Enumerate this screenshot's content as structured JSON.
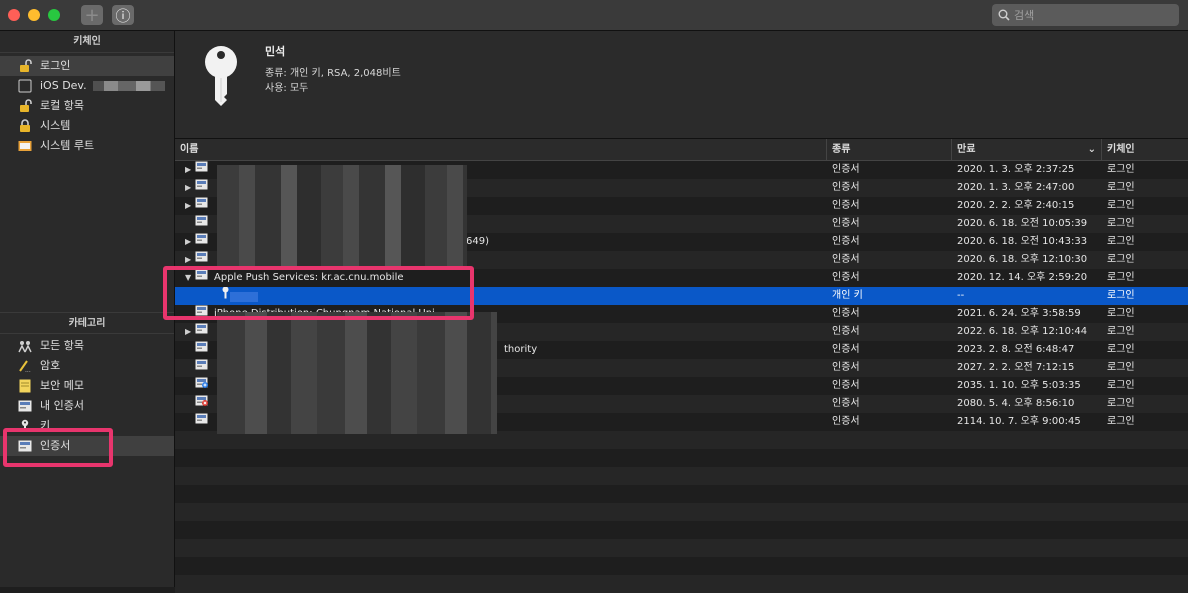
{
  "window": {
    "search_placeholder": "검색",
    "add_button": "+",
    "info_button": "ⓘ"
  },
  "sidebar": {
    "keychains_header": "키체인",
    "keychains": [
      {
        "label": "로그인",
        "icon": "open-lock-icon",
        "selected": true
      },
      {
        "label": "iOS Dev.",
        "icon": "dotted-box-icon"
      },
      {
        "label": "로컬 항목",
        "icon": "open-lock-icon"
      },
      {
        "label": "시스템",
        "icon": "lock-icon"
      },
      {
        "label": "시스템 루트",
        "icon": "folder-icon"
      }
    ],
    "categories_header": "카테고리",
    "categories": [
      {
        "label": "모든 항목",
        "icon": "people-icon"
      },
      {
        "label": "암호",
        "icon": "pencil-icon"
      },
      {
        "label": "보안 메모",
        "icon": "note-icon"
      },
      {
        "label": "내 인증서",
        "icon": "certificate-icon"
      },
      {
        "label": "키",
        "icon": "key-icon"
      },
      {
        "label": "인증서",
        "icon": "certificate-icon",
        "selected": true
      }
    ]
  },
  "detail": {
    "name": "민석",
    "kind_line": "종류: 개인 키, RSA, 2,048비트",
    "usage_line": "사용: 모두"
  },
  "table": {
    "columns": {
      "name": "이름",
      "kind": "종류",
      "expires": "만료",
      "keychain": "키체인"
    },
    "rows": [
      {
        "name": "",
        "expandable": true,
        "kind": "인증서",
        "expires": "2020. 1. 3. 오후 2:37:25",
        "keychain": "로그인"
      },
      {
        "name": "",
        "expandable": true,
        "kind": "인증서",
        "expires": "2020. 1. 3. 오후 2:47:00",
        "keychain": "로그인"
      },
      {
        "name": "",
        "expandable": true,
        "kind": "인증서",
        "expires": "2020. 2. 2. 오후 2:40:15",
        "keychain": "로그인"
      },
      {
        "name": "",
        "expandable": false,
        "kind": "인증서",
        "expires": "2020. 6. 18. 오전 10:05:39",
        "keychain": "로그인"
      },
      {
        "name": "649)",
        "expandable": true,
        "kind": "인증서",
        "expires": "2020. 6. 18. 오전 10:43:33",
        "keychain": "로그인"
      },
      {
        "name": "",
        "expandable": true,
        "kind": "인증서",
        "expires": "2020. 6. 18. 오후 12:10:30",
        "keychain": "로그인"
      },
      {
        "name": "Apple Push Services: kr.ac.cnu.mobile",
        "expandable": true,
        "expanded": true,
        "kind": "인증서",
        "expires": "2020. 12. 14. 오후 2:59:20",
        "keychain": "로그인"
      },
      {
        "name": "",
        "child": true,
        "key": true,
        "kind": "개인 키",
        "expires": "--",
        "keychain": "로그인",
        "selected": true
      },
      {
        "name": "iPhone Distribution: Chungnam National Uni",
        "expandable": false,
        "kind": "인증서",
        "expires": "2021. 6. 24. 오후 3:58:59",
        "keychain": "로그인"
      },
      {
        "name": "",
        "expandable": true,
        "kind": "인증서",
        "expires": "2022. 6. 18. 오후 12:10:44",
        "keychain": "로그인"
      },
      {
        "name": "thority",
        "expandable": false,
        "kind": "인증서",
        "expires": "2023. 2. 8. 오전 6:48:47",
        "keychain": "로그인"
      },
      {
        "name": "",
        "expandable": false,
        "kind": "인증서",
        "expires": "2027. 2. 2. 오전 7:12:15",
        "keychain": "로그인"
      },
      {
        "name": "",
        "expandable": false,
        "icon": "plus-cert",
        "kind": "인증서",
        "expires": "2035. 1. 10. 오후 5:03:35",
        "keychain": "로그인"
      },
      {
        "name": "",
        "expandable": false,
        "icon": "x-cert",
        "kind": "인증서",
        "expires": "2080. 5. 4. 오후 8:56:10",
        "keychain": "로그인"
      },
      {
        "name": "",
        "expandable": false,
        "kind": "인증서",
        "expires": "2114. 10. 7. 오후 9:00:45",
        "keychain": "로그인"
      }
    ]
  }
}
